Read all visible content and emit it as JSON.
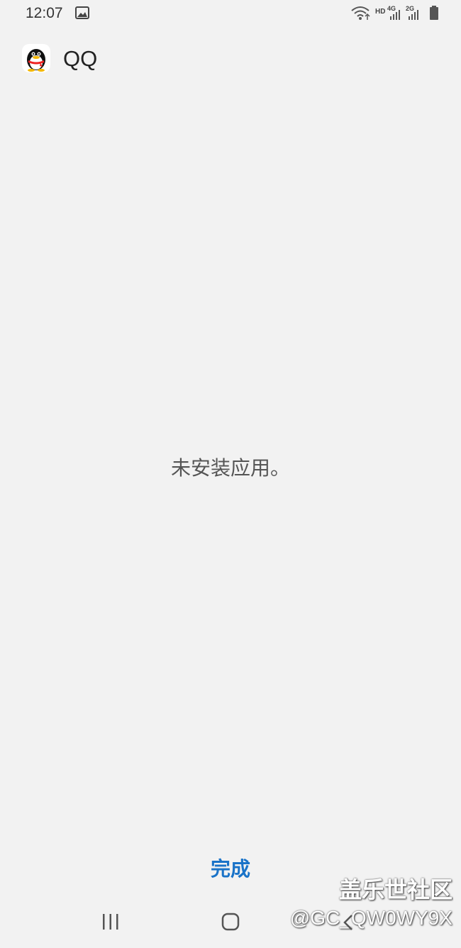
{
  "status_bar": {
    "time": "12:07",
    "network_hd": "HD",
    "signal_1": "4G",
    "signal_2": "2G"
  },
  "app": {
    "name": "QQ",
    "icon": "qq-penguin-icon"
  },
  "message": "未安装应用。",
  "done_label": "完成",
  "watermark": {
    "title": "盖乐世社区",
    "handle": "@GC_QW0WY9X"
  },
  "colors": {
    "background": "#f2f2f2",
    "accent": "#1a73c8",
    "message_text": "#555555"
  }
}
